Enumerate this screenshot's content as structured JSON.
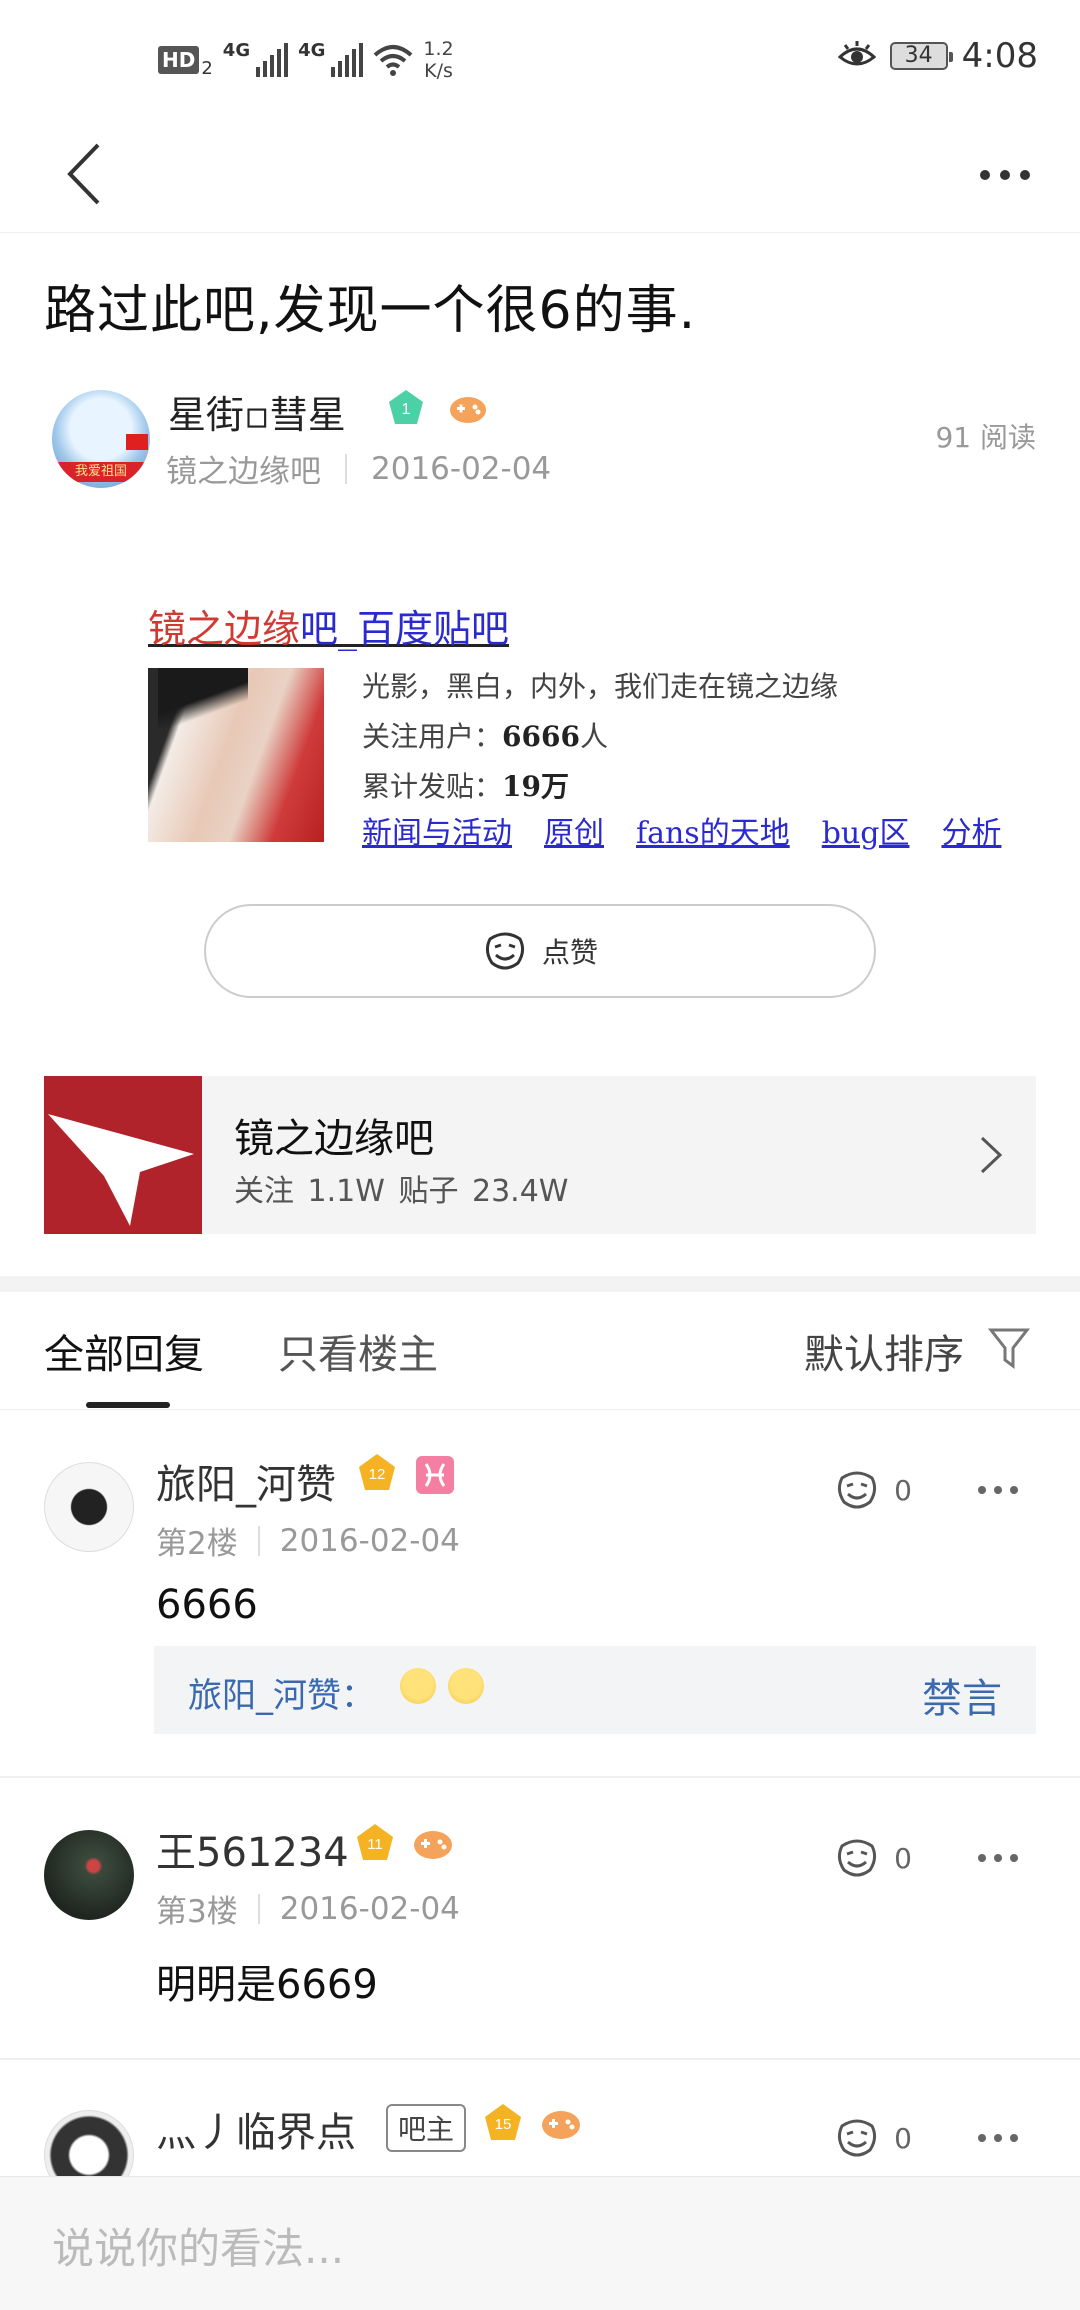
{
  "status_bar": {
    "hd": "HD",
    "sim": "2",
    "net1": "4G",
    "net2": "4G",
    "speed_value": "1.2",
    "speed_unit": "K/s",
    "battery": "34",
    "time": "4:08"
  },
  "post": {
    "title": "路过此吧,发现一个很6的事.",
    "author": "星街▫彗星",
    "author_level": "1",
    "forum": "镜之边缘吧",
    "date": "2016-02-04",
    "read_count": "91 阅读",
    "avatar_banner": "我爱祖国"
  },
  "embed": {
    "title_red": "镜之边缘",
    "title_blue": "吧_百度贴吧",
    "line1": "光影，黑白，内外，我们走在镜之边缘",
    "line2_label": "关注用户：",
    "line2_value": "6666",
    "line2_unit": "人",
    "line3_label": "累计发贴：",
    "line3_value": "19万",
    "links": [
      "新闻与活动",
      "原创",
      "fans的天地",
      "bug区",
      "分析"
    ]
  },
  "like_button": {
    "label": "点赞"
  },
  "forum_card": {
    "name": "镜之边缘吧",
    "stats": "关注 1.1W   贴子 23.4W"
  },
  "tabs": {
    "all": "全部回复",
    "owner_only": "只看楼主",
    "sort": "默认排序"
  },
  "comments": [
    {
      "name": "旅阳_河赞",
      "level": "12",
      "floor": "第2楼",
      "date": "2016-02-04",
      "likes": "0",
      "text": "6666",
      "subreply_name": "旅阳_河赞：",
      "subreply_action": "禁言"
    },
    {
      "name": "王561234",
      "level": "11",
      "floor": "第3楼",
      "date": "2016-02-04",
      "likes": "0",
      "text": "明明是6669"
    },
    {
      "name": "灬丿临界点",
      "tag": "吧主",
      "level": "15",
      "likes": "0"
    }
  ],
  "bottom": {
    "placeholder": "说说你的看法..."
  },
  "colors": {
    "link_blue": "#2a2ad0",
    "title_red": "#d03a32",
    "reply_blue": "#3b69b0",
    "forum_red": "#b0232a"
  }
}
